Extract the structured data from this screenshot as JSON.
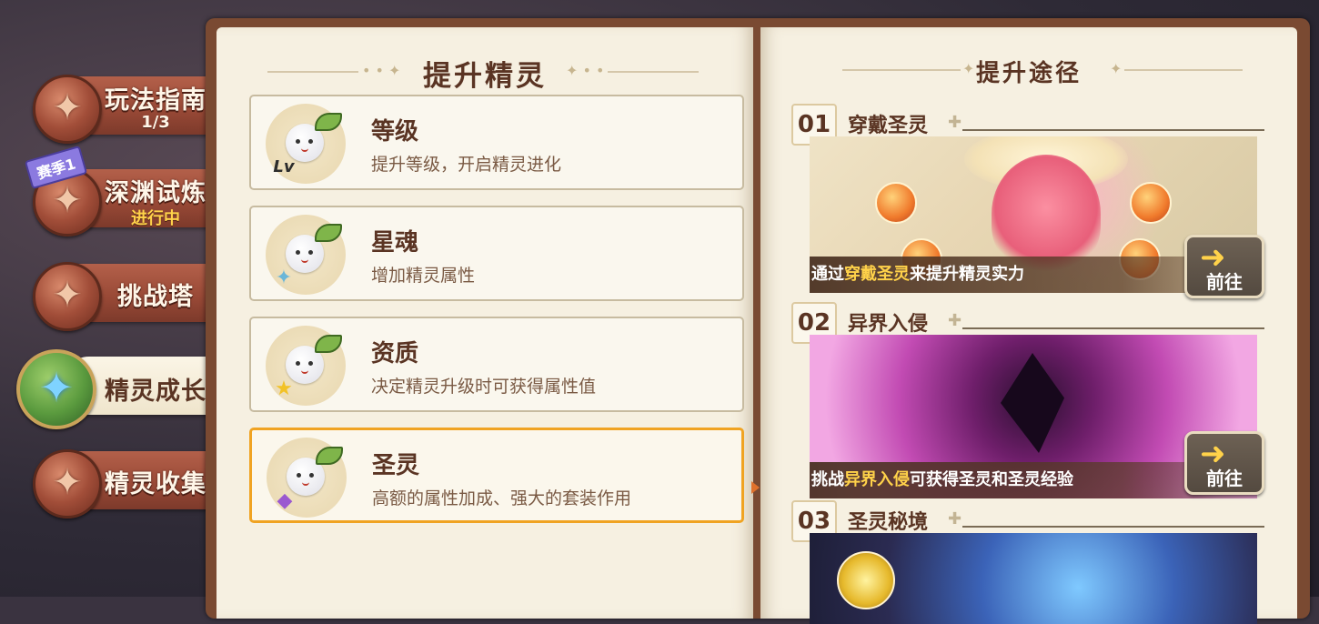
{
  "left_nav": {
    "tabs": [
      {
        "label": "玩法指南",
        "sub": "1/3"
      },
      {
        "label": "深渊试炼",
        "sub": "进行中",
        "badge": "赛季1"
      },
      {
        "label": "挑战塔",
        "sub": ""
      },
      {
        "label": "精灵成长",
        "sub": ""
      },
      {
        "label": "精灵收集",
        "sub": ""
      }
    ],
    "active_index": 3
  },
  "left_page": {
    "title": "提升精灵",
    "items": [
      {
        "title": "等级",
        "desc": "提升等级，开启精灵进化",
        "badge": "Lv"
      },
      {
        "title": "星魂",
        "desc": "增加精灵属性",
        "badge": "✦"
      },
      {
        "title": "资质",
        "desc": "决定精灵升级时可获得属性值",
        "badge": "★"
      },
      {
        "title": "圣灵",
        "desc": "高额的属性加成、强大的套装作用",
        "badge": "◆"
      }
    ],
    "selected_index": 3
  },
  "right_page": {
    "title": "提升途径",
    "sections": [
      {
        "num": "01",
        "title": "穿戴圣灵",
        "caption_pre": "通过",
        "caption_hl": "穿戴圣灵",
        "caption_post": "来提升精灵实力",
        "button": "前往"
      },
      {
        "num": "02",
        "title": "异界入侵",
        "caption_pre": "挑战",
        "caption_hl": "异界入侵",
        "caption_post": "可获得圣灵和圣灵经验",
        "button": "前往"
      },
      {
        "num": "03",
        "title": "圣灵秘境"
      }
    ]
  },
  "colors": {
    "accent_selected": "#f0a322",
    "highlight_text": "#ffd24a",
    "heading_brown": "#5a3423",
    "page_bg": "#f6f0e1"
  }
}
